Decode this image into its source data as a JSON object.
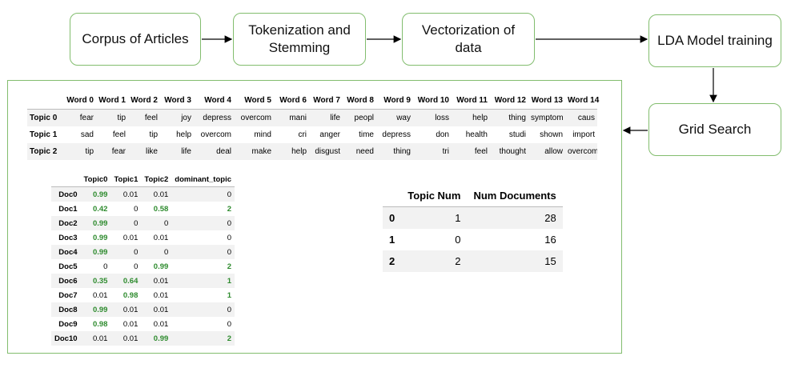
{
  "flow": {
    "corpus": "Corpus of Articles",
    "tokenization": "Tokenization and Stemming",
    "vectorization": "Vectorization of data",
    "lda": "LDA Model training",
    "grid": "Grid Search"
  },
  "word_table": {
    "headers": [
      "",
      "Word 0",
      "Word 1",
      "Word 2",
      "Word 3",
      "Word 4",
      "Word 5",
      "Word 6",
      "Word 7",
      "Word 8",
      "Word 9",
      "Word 10",
      "Word 11",
      "Word 12",
      "Word 13",
      "Word 14"
    ],
    "rows": [
      [
        "Topic 0",
        "fear",
        "tip",
        "feel",
        "joy",
        "depress",
        "overcom",
        "mani",
        "life",
        "peopl",
        "way",
        "loss",
        "help",
        "thing",
        "symptom",
        "caus"
      ],
      [
        "Topic 1",
        "sad",
        "feel",
        "tip",
        "help",
        "overcom",
        "mind",
        "cri",
        "anger",
        "time",
        "depress",
        "don",
        "health",
        "studi",
        "shown",
        "import"
      ],
      [
        "Topic 2",
        "tip",
        "fear",
        "like",
        "life",
        "deal",
        "make",
        "help",
        "disgust",
        "need",
        "thing",
        "tri",
        "feel",
        "thought",
        "allow",
        "overcom"
      ]
    ]
  },
  "doc_table": {
    "headers": [
      "",
      "Topic0",
      "Topic1",
      "Topic2",
      "dominant_topic"
    ],
    "rows": [
      [
        "Doc0",
        "0.99",
        "0.01",
        "0.01",
        "0"
      ],
      [
        "Doc1",
        "0.42",
        "0",
        "0.58",
        "2"
      ],
      [
        "Doc2",
        "0.99",
        "0",
        "0",
        "0"
      ],
      [
        "Doc3",
        "0.99",
        "0.01",
        "0.01",
        "0"
      ],
      [
        "Doc4",
        "0.99",
        "0",
        "0",
        "0"
      ],
      [
        "Doc5",
        "0",
        "0",
        "0.99",
        "2"
      ],
      [
        "Doc6",
        "0.35",
        "0.64",
        "0.01",
        "1"
      ],
      [
        "Doc7",
        "0.01",
        "0.98",
        "0.01",
        "1"
      ],
      [
        "Doc8",
        "0.99",
        "0.01",
        "0.01",
        "0"
      ],
      [
        "Doc9",
        "0.98",
        "0.01",
        "0.01",
        "0"
      ],
      [
        "Doc10",
        "0.01",
        "0.01",
        "0.99",
        "2"
      ]
    ],
    "highlight_color": "#2e8b2e"
  },
  "topic_table": {
    "headers": [
      "",
      "Topic Num",
      "Num Documents"
    ],
    "rows": [
      [
        "0",
        "1",
        "28"
      ],
      [
        "1",
        "0",
        "16"
      ],
      [
        "2",
        "2",
        "15"
      ]
    ]
  },
  "colors": {
    "box_border": "#82bd6e",
    "arrow": "#000000",
    "stripe": "#f2f2f2"
  }
}
